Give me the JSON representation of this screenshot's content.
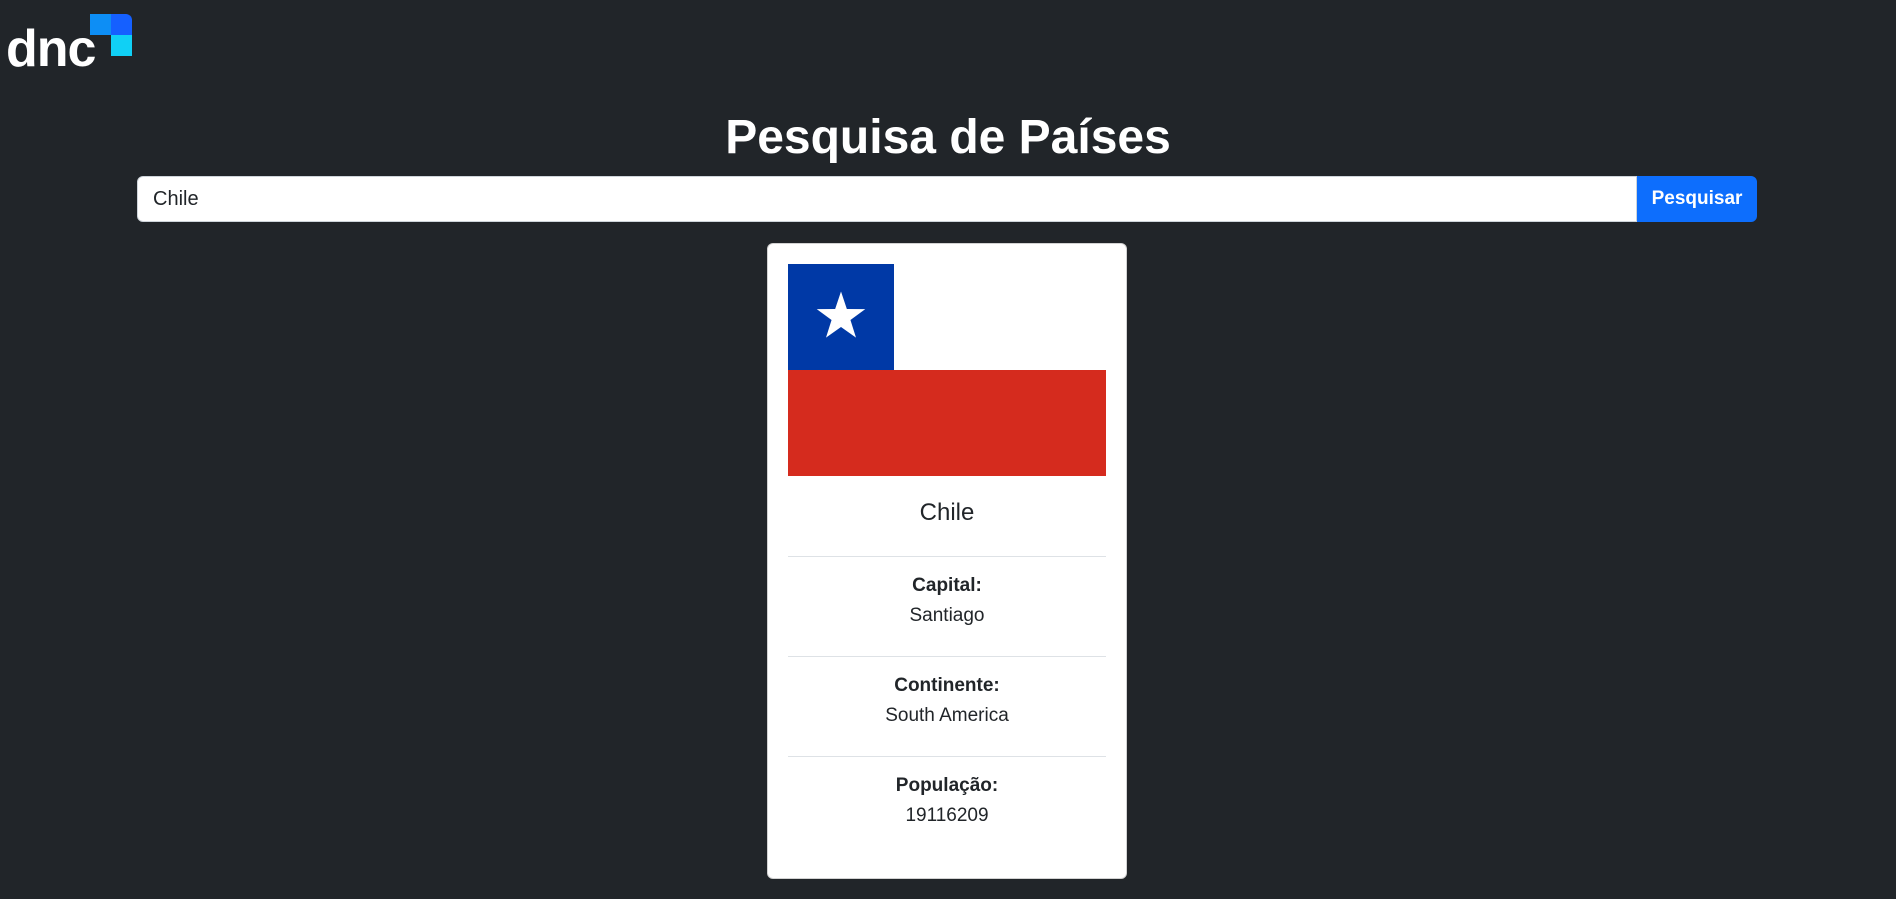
{
  "brand": {
    "logo_text": "dnc",
    "colors": {
      "mark_light": "#0d8ef5",
      "mark_blue": "#1560ff",
      "mark_cyan": "#10d0f5"
    }
  },
  "header": {
    "title": "Pesquisa de Países"
  },
  "search": {
    "value": "Chile",
    "button_label": "Pesquisar",
    "accent_color": "#0d6efd"
  },
  "result": {
    "flag_icon": "chile-flag-icon",
    "flag_colors": {
      "blue": "#0039a6",
      "white": "#ffffff",
      "red": "#d52b1e"
    },
    "country_name": "Chile",
    "capital_label": "Capital:",
    "capital_value": "Santiago",
    "continent_label": "Continente:",
    "continent_value": "South America",
    "population_label": "População:",
    "population_value": "19116209"
  }
}
